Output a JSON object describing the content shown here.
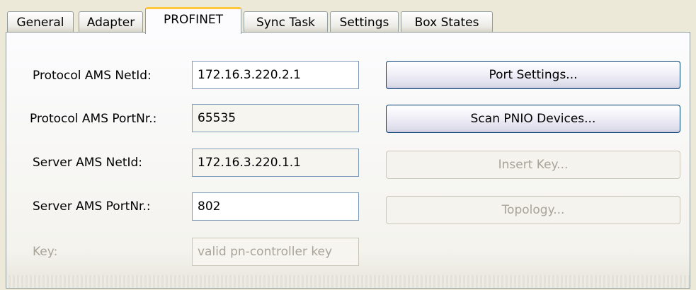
{
  "tabs": [
    {
      "label": "General"
    },
    {
      "label": "Adapter"
    },
    {
      "label": "PROFINET",
      "active": true
    },
    {
      "label": "Sync Task"
    },
    {
      "label": "Settings"
    },
    {
      "label": "Box States"
    }
  ],
  "form": {
    "protocol_netid": {
      "label": "Protocol AMS NetId:",
      "value": "172.16.3.220.2.1"
    },
    "protocol_portnr": {
      "label": "Protocol AMS PortNr.:",
      "value": "65535"
    },
    "server_netid": {
      "label": "Server AMS NetId:",
      "value": "172.16.3.220.1.1"
    },
    "server_portnr": {
      "label": "Server AMS PortNr.:",
      "value": "802"
    },
    "key": {
      "label": "Key:",
      "value": "valid pn-controller key"
    }
  },
  "buttons": {
    "port_settings": "Port Settings...",
    "scan_pnio": "Scan PNIO Devices...",
    "insert_key": "Insert Key...",
    "topology": "Topology..."
  },
  "colors": {
    "active_tab_accent": "#ffc83c",
    "button_border": "#003c74",
    "field_border": "#7f9db9",
    "disabled_text": "#a7a49a"
  }
}
